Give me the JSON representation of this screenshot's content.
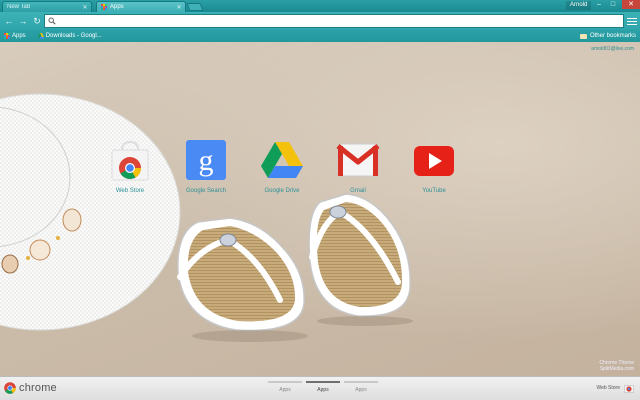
{
  "tabs": [
    {
      "title": "New Tab",
      "active": false
    },
    {
      "title": "Apps",
      "active": true
    }
  ],
  "profile": {
    "name": "Arnold"
  },
  "window_controls": {
    "minimize": "–",
    "maximize": "□",
    "close": "✕"
  },
  "omnibox": {
    "value": "",
    "placeholder": ""
  },
  "bookmarks": {
    "items": [
      {
        "label": "Apps",
        "icon": "apps-grid-icon"
      },
      {
        "label": "Downloads - Googl...",
        "icon": "drive-icon"
      }
    ],
    "other": "Other bookmarks"
  },
  "user": {
    "email": "arnold01@live.com"
  },
  "apps": [
    {
      "label": "Web Store",
      "icon": "web-store-icon"
    },
    {
      "label": "Google Search",
      "icon": "google-search-icon"
    },
    {
      "label": "Google Drive",
      "icon": "google-drive-icon"
    },
    {
      "label": "Gmail",
      "icon": "gmail-icon"
    },
    {
      "label": "YouTube",
      "icon": "youtube-icon"
    }
  ],
  "watermark": {
    "line1": "Chrome Theme",
    "line2": "SplitMedia.com"
  },
  "bottom": {
    "brand": "chrome",
    "pages": [
      {
        "label": "Apps",
        "active": false
      },
      {
        "label": "Apps",
        "active": true
      },
      {
        "label": "Apps",
        "active": false
      }
    ],
    "webstore": "Web Store"
  },
  "colors": {
    "accent": "#2ea5aa",
    "link": "#2d9096",
    "close": "#c7463b"
  }
}
